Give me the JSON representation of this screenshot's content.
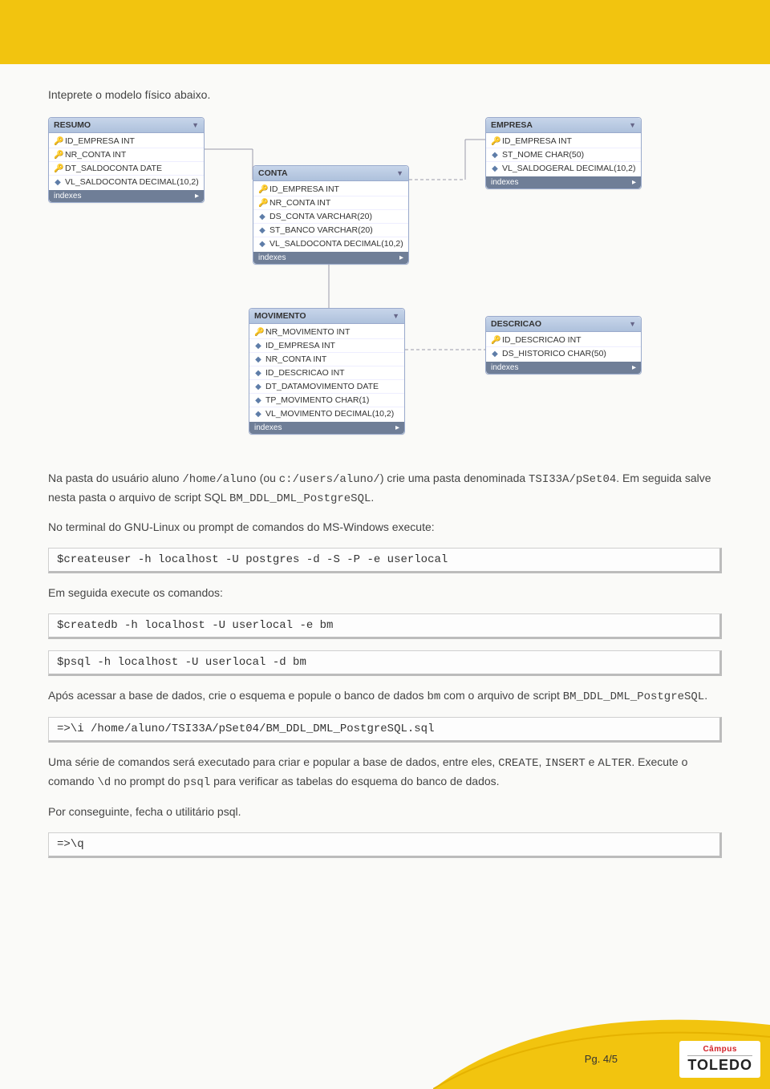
{
  "intro": "Inteprete o modelo físico abaixo.",
  "entities": {
    "resumo": {
      "title": "RESUMO",
      "attrs": [
        {
          "icon": "pk",
          "text": "ID_EMPRESA INT"
        },
        {
          "icon": "pk",
          "text": "NR_CONTA INT"
        },
        {
          "icon": "pk",
          "text": "DT_SALDOCONTA DATE"
        },
        {
          "icon": "col",
          "text": "VL_SALDOCONTA DECIMAL(10,2)"
        }
      ],
      "indexes": "indexes"
    },
    "conta": {
      "title": "CONTA",
      "attrs": [
        {
          "icon": "pk",
          "text": "ID_EMPRESA INT"
        },
        {
          "icon": "pk",
          "text": "NR_CONTA INT"
        },
        {
          "icon": "col",
          "text": "DS_CONTA VARCHAR(20)"
        },
        {
          "icon": "col",
          "text": "ST_BANCO VARCHAR(20)"
        },
        {
          "icon": "col",
          "text": "VL_SALDOCONTA DECIMAL(10,2)"
        }
      ],
      "indexes": "indexes"
    },
    "empresa": {
      "title": "EMPRESA",
      "attrs": [
        {
          "icon": "pk",
          "text": "ID_EMPRESA INT"
        },
        {
          "icon": "col",
          "text": "ST_NOME CHAR(50)"
        },
        {
          "icon": "col",
          "text": "VL_SALDOGERAL DECIMAL(10,2)"
        }
      ],
      "indexes": "indexes"
    },
    "movimento": {
      "title": "MOVIMENTO",
      "attrs": [
        {
          "icon": "pk",
          "text": "NR_MOVIMENTO INT"
        },
        {
          "icon": "col",
          "text": "ID_EMPRESA INT"
        },
        {
          "icon": "col",
          "text": "NR_CONTA INT"
        },
        {
          "icon": "col",
          "text": "ID_DESCRICAO INT"
        },
        {
          "icon": "col",
          "text": "DT_DATAMOVIMENTO DATE"
        },
        {
          "icon": "col",
          "text": "TP_MOVIMENTO CHAR(1)"
        },
        {
          "icon": "col",
          "text": "VL_MOVIMENTO DECIMAL(10,2)"
        }
      ],
      "indexes": "indexes"
    },
    "descricao": {
      "title": "DESCRICAO",
      "attrs": [
        {
          "icon": "pk",
          "text": "ID_DESCRICAO INT"
        },
        {
          "icon": "col",
          "text": "DS_HISTORICO CHAR(50)"
        }
      ],
      "indexes": "indexes"
    }
  },
  "p1a": "Na pasta do usuário aluno ",
  "p1b": "/home/aluno",
  "p1c": " (ou ",
  "p1d": "c:/users/aluno/",
  "p1e": ") crie uma pasta denominada ",
  "p1f": "TSI33A/pSet04",
  "p1g": ". Em seguida salve nesta pasta o arquivo de script SQL ",
  "p1h": "BM_DDL_DML_PostgreSQL",
  "p1i": ".",
  "p2": "No terminal do GNU-Linux ou prompt de comandos do MS-Windows execute:",
  "cmd1": "$createuser -h localhost -U postgres -d -S -P -e userlocal",
  "p3": "Em seguida execute os comandos:",
  "cmd2": "$createdb -h localhost -U userlocal -e bm",
  "cmd3": "$psql -h localhost -U userlocal -d bm",
  "p4a": "Após acessar a base de dados, crie o esquema e popule o banco de dados ",
  "p4b": "bm",
  "p4c": " com o arquivo de script ",
  "p4d": "BM_DDL_DML_PostgreSQL",
  "p4e": ".",
  "cmd4": "=>\\i /home/aluno/TSI33A/pSet04/BM_DDL_DML_PostgreSQL.sql",
  "p5a": "Uma série de comandos será executado para criar e popular a base de dados, entre eles, ",
  "p5b": "CREATE",
  "p5c": ", ",
  "p5d": "INSERT",
  "p5e": " e ",
  "p5f": "ALTER",
  "p5g": ". Execute o comando ",
  "p5h": "\\d",
  "p5i": " no prompt do ",
  "p5j": "psql",
  "p5k": " para verificar as tabelas do esquema do banco de dados.",
  "p6": "Por conseguinte, fecha o utilitário psql.",
  "cmd5": "=>\\q",
  "pagenum": "Pg. 4/5",
  "logo": {
    "campus": "Câmpus",
    "toledo": "TOLEDO"
  }
}
